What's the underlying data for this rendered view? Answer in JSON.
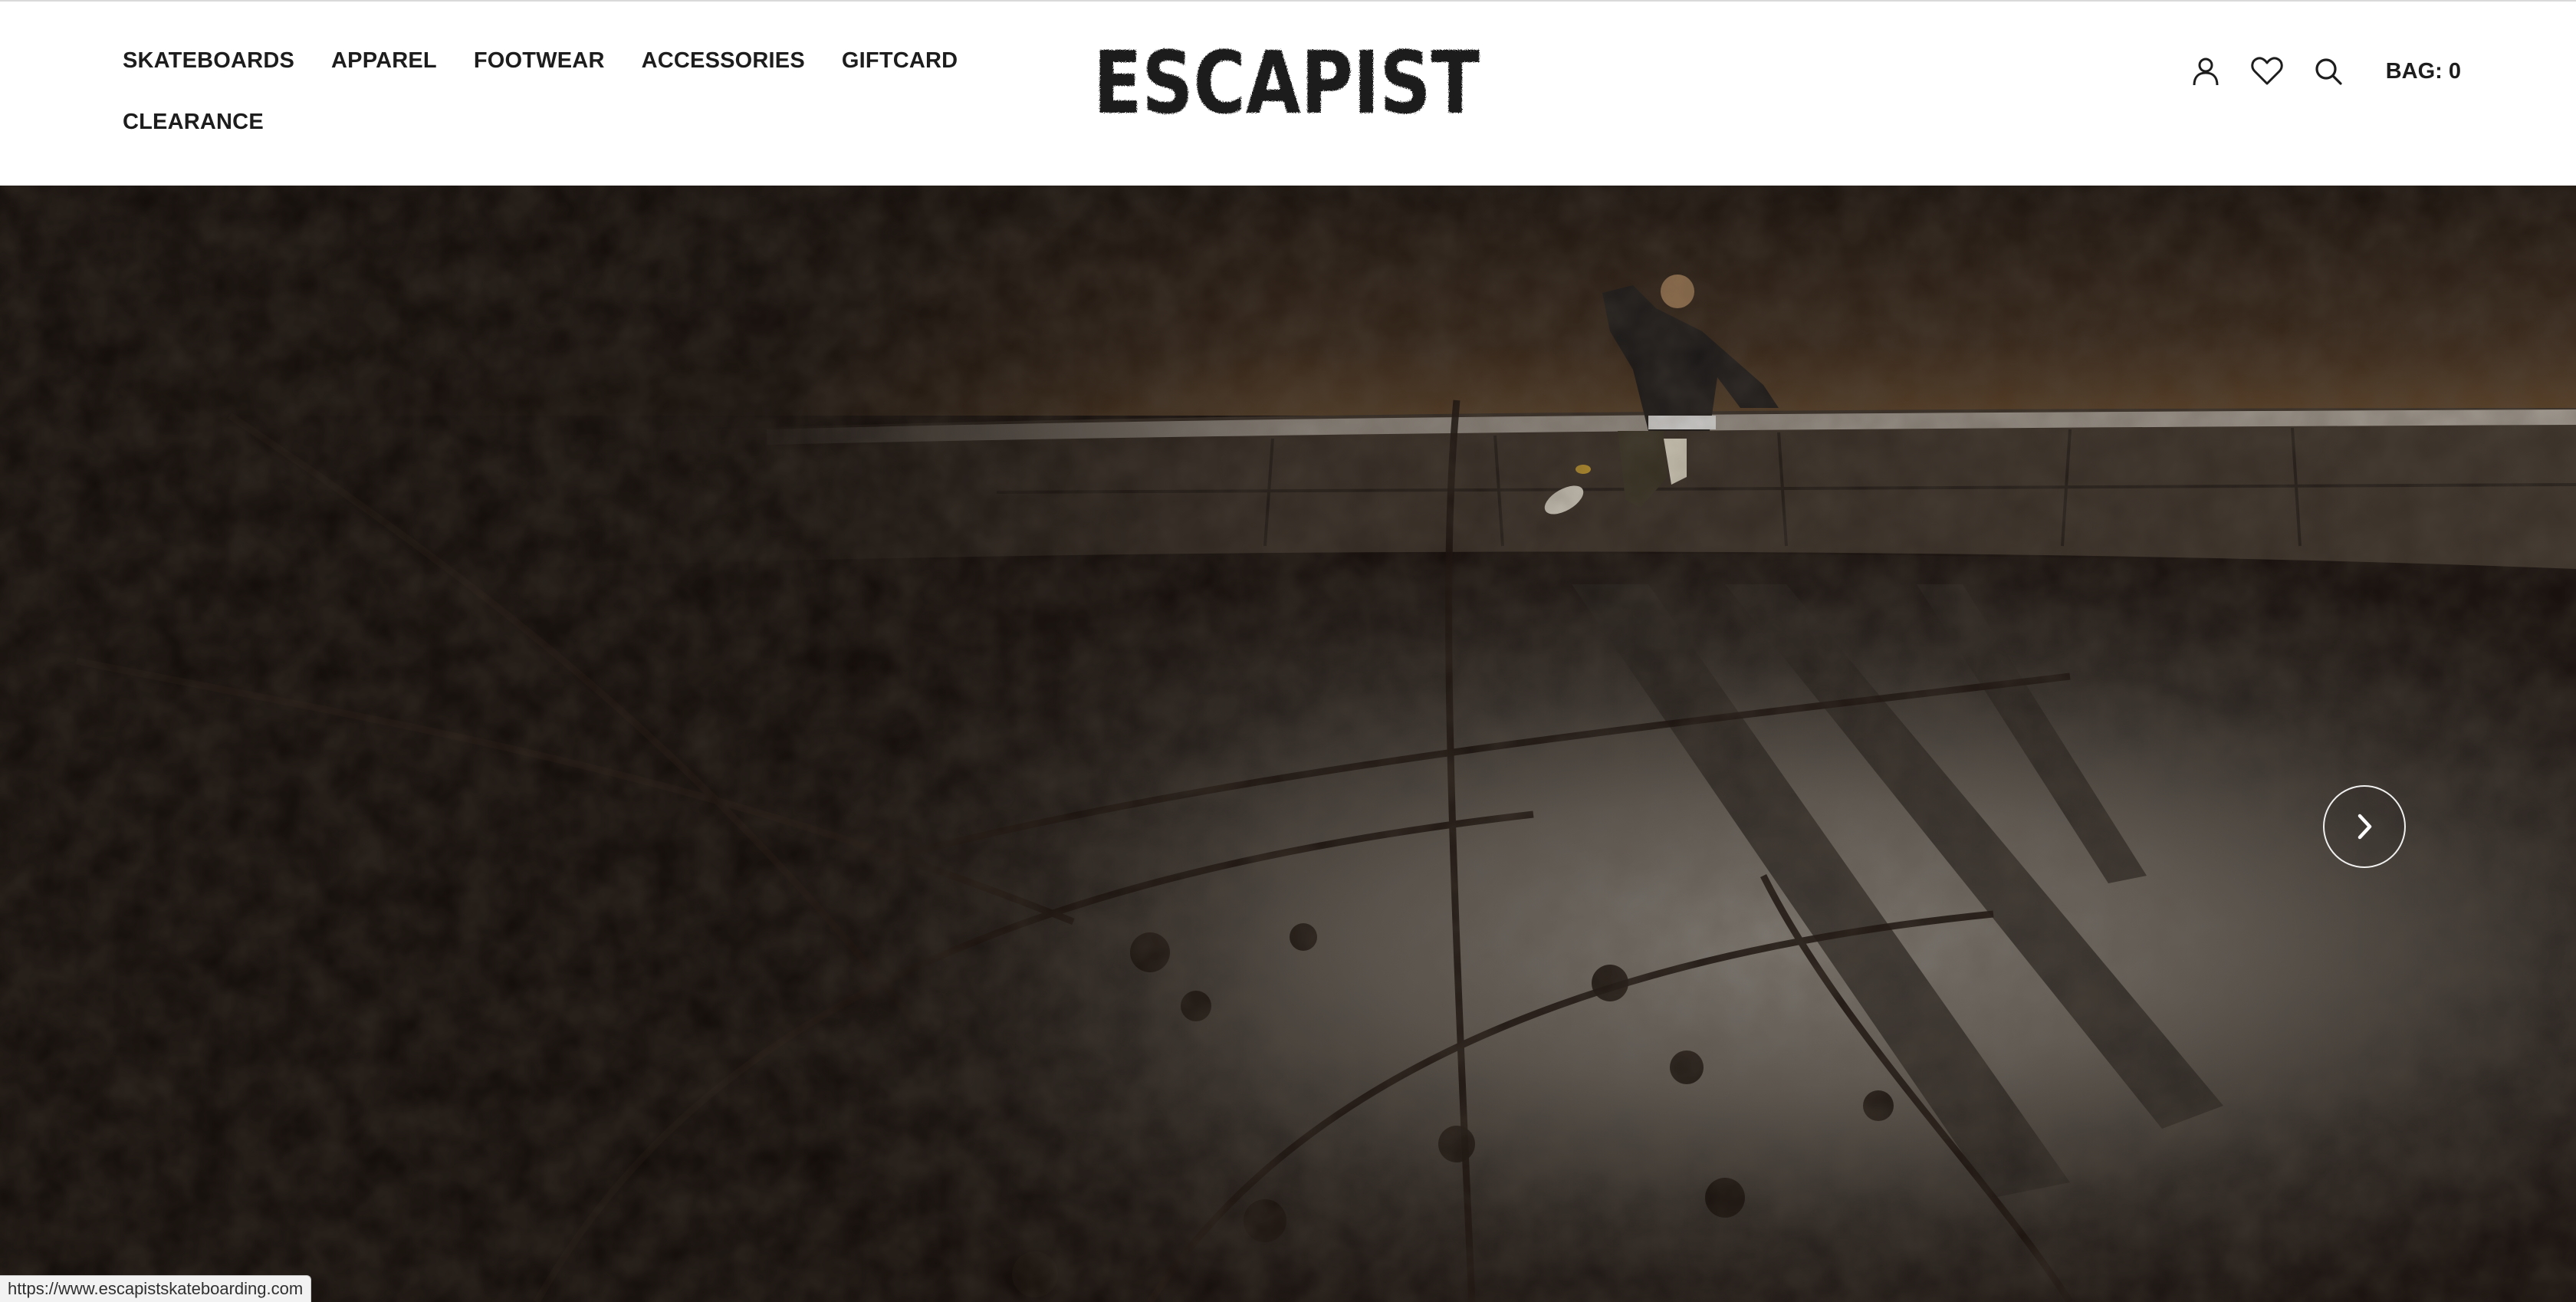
{
  "header": {
    "nav": [
      {
        "label": "SKATEBOARDS"
      },
      {
        "label": "APPAREL"
      },
      {
        "label": "FOOTWEAR"
      },
      {
        "label": "ACCESSORIES"
      },
      {
        "label": "GIFTCARD"
      },
      {
        "label": "CLEARANCE"
      }
    ],
    "logo_text": "ESCAPIST",
    "icons": {
      "account": "user-icon",
      "wishlist": "heart-icon",
      "search": "search-icon"
    },
    "bag_label": "BAG: 0"
  },
  "hero": {
    "slider_next_icon": "chevron-right-icon"
  },
  "status_bar": {
    "url": "https://www.escapistskateboarding.com"
  },
  "colors": {
    "text": "#1d1d1d",
    "header_bg": "#ffffff",
    "hero_dark": "#140d0a"
  }
}
